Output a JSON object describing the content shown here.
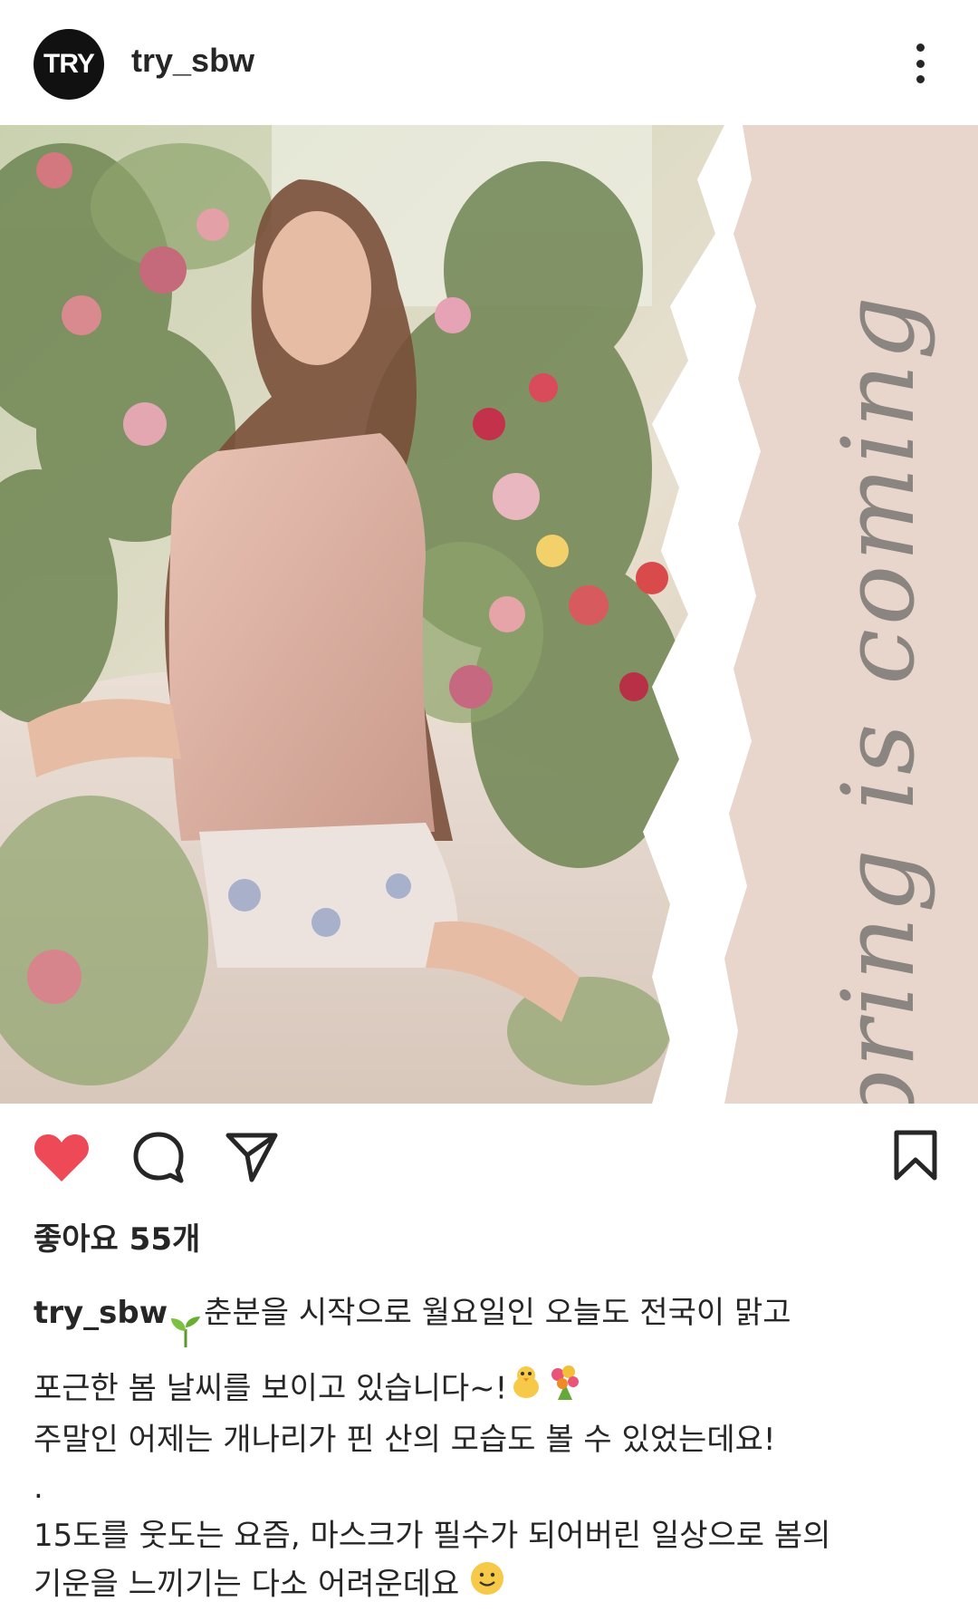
{
  "post": {
    "username": "try_sbw",
    "avatar_text": "TRY",
    "image_overlay_text": "spring is coming",
    "likes_text": "좋아요 55개",
    "caption": {
      "username": "try_sbw",
      "line1": "춘분을 시작으로 월요일인 오늘도 전국이 맑고",
      "line2": "포근한 봄 날씨를 보이고 있습니다~!",
      "line3": "주말인 어제는 개나리가 핀 산의 모습도 볼 수 있었는데요!",
      "line4": ".",
      "line5": "15도를 웃도는 요즘, 마스크가 필수가 되어버린 일상으로 봄의",
      "line6": "기운을 느끼기는 다소 어려운데요"
    }
  },
  "icons": {
    "more": "more-vertical-icon",
    "like": "heart-filled-icon",
    "comment": "comment-icon",
    "share": "send-icon",
    "save": "bookmark-icon",
    "seedling": "seedling-emoji",
    "chick": "chick-emoji",
    "bouquet": "bouquet-emoji",
    "smile": "smile-emoji"
  },
  "colors": {
    "like": "#ed4956",
    "text": "#262626",
    "panel": "#e8d5cb"
  }
}
